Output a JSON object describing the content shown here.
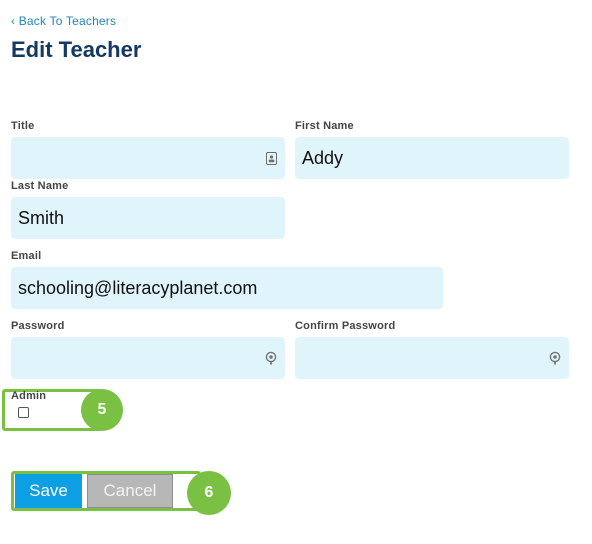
{
  "nav": {
    "back_label": "‹ Back To Teachers"
  },
  "page": {
    "title": "Edit Teacher"
  },
  "form": {
    "title_label": "Title",
    "title_value": "",
    "first_name_label": "First Name",
    "first_name_value": "Addy",
    "last_name_label": "Last Name",
    "last_name_value": "Smith",
    "email_label": "Email",
    "email_value": "schooling@literacyplanet.com",
    "password_label": "Password",
    "password_value": "",
    "confirm_password_label": "Confirm Password",
    "confirm_password_value": "",
    "admin_label": "Admin",
    "admin_checked": false
  },
  "actions": {
    "save_label": "Save",
    "cancel_label": "Cancel"
  },
  "annotations": {
    "step_admin": "5",
    "step_buttons": "6"
  },
  "colors": {
    "accent": "#7ac143",
    "field_bg": "#e0f4fb",
    "title": "#143a63",
    "link": "#1f86b8",
    "save_bg": "#0d9fe3",
    "cancel_bg": "#b7b7b7"
  },
  "icons": {
    "title_field": "contact-card-icon",
    "password_field": "password-reveal-icon",
    "confirm_password_field": "password-reveal-icon"
  }
}
